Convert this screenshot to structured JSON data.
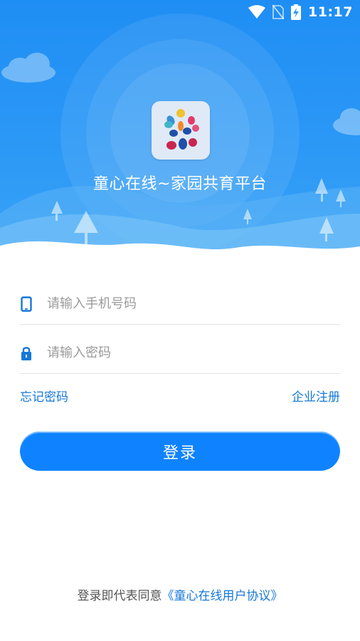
{
  "status_bar": {
    "time": "11:17",
    "icons": [
      "wifi-icon",
      "no-sim-icon",
      "battery-charging-icon"
    ]
  },
  "header": {
    "logo_icon": "app-logo-icon",
    "title": "童心在线~家园共育平台"
  },
  "login_form": {
    "phone_placeholder": "请输入手机号码",
    "phone_icon": "phone-icon",
    "password_placeholder": "请输入密码",
    "password_icon": "lock-icon",
    "forgot_password": "忘记密码",
    "enterprise_register": "企业注册",
    "login_button": "登录"
  },
  "footer": {
    "agreement_prefix": "登录即代表同意",
    "agreement_link": "《童心在线用户协议》"
  },
  "colors": {
    "primary": "#0f83ff",
    "hero": "#2b98f6",
    "link": "#1577d9"
  }
}
